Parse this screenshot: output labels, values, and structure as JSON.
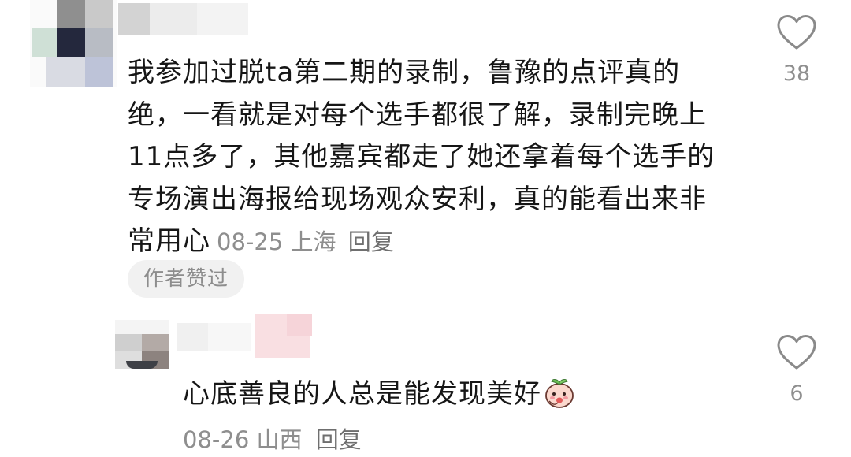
{
  "comment1": {
    "text": "我参加过脱ta第二期的录制，鲁豫的点评真的绝，一看就是对每个选手都很了解，录制完晚上11点多了，其他嘉宾都走了她还拿着每个选手的专场演出海报给现场观众安利，真的能看出来非常用心",
    "date": "08-25",
    "location": "上海",
    "reply_label": "回复",
    "author_badge": "作者赞过",
    "like_count": "38",
    "like_icon": "heart-outline-icon"
  },
  "comment2": {
    "text": "心底善良的人总是能发现美好",
    "emoji": "peach-emoji-icon",
    "date": "08-26",
    "location": "山西",
    "reply_label": "回复",
    "like_count": "6",
    "like_icon": "heart-outline-icon"
  },
  "colors": {
    "text_primary": "#161616",
    "text_meta": "#8e8e8e",
    "badge_bg": "#f1f1f1",
    "icon_stroke": "#8a8a8a"
  }
}
